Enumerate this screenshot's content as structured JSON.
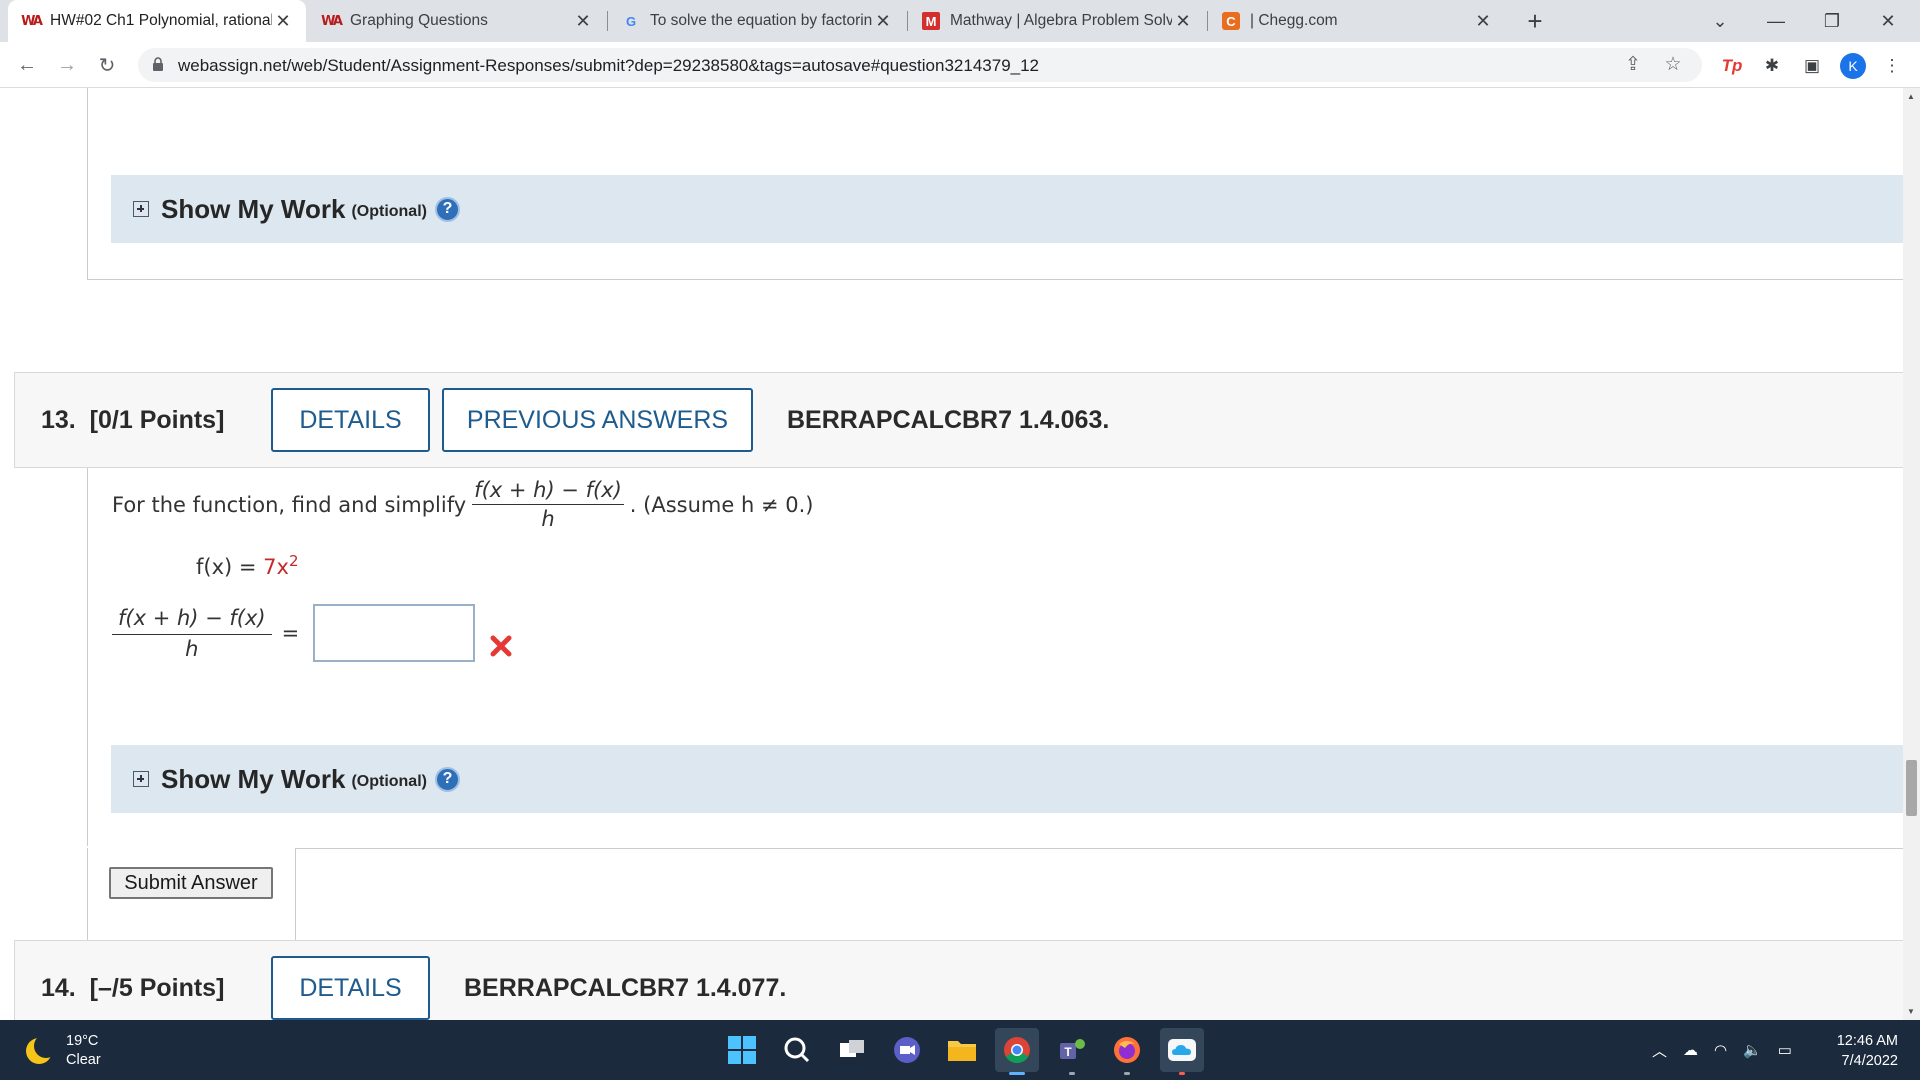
{
  "browser": {
    "tabs": [
      {
        "title": "HW#02 Ch1 Polynomial, rational",
        "favicon": "webassign-icon",
        "active": true
      },
      {
        "title": "Graphing Questions",
        "favicon": "webassign-icon",
        "active": false
      },
      {
        "title": "To solve the equation by factorin",
        "favicon": "google-icon",
        "active": false
      },
      {
        "title": "Mathway | Algebra Problem Solv",
        "favicon": "mathway-icon",
        "active": false
      },
      {
        "title": "| Chegg.com",
        "favicon": "chegg-icon",
        "active": false
      }
    ],
    "url": "webassign.net/web/Student/Assignment-Responses/submit?dep=29238580&tags=autosave#question3214379_12",
    "profile_initial": "K",
    "tp_label": "Tp"
  },
  "page": {
    "prev_question": {
      "show_work_title": "Show My Work",
      "show_work_optional": "(Optional)"
    },
    "q13": {
      "number": "13.",
      "points": "[0/1 Points]",
      "details_label": "DETAILS",
      "previous_answers_label": "PREVIOUS ANSWERS",
      "code": "BERRAPCALCBR7 1.4.063.",
      "prompt_before": "For the function, find and simplify",
      "frac_num": "f(x + h) − f(x)",
      "frac_den": "h",
      "prompt_after": ". (Assume h ≠ 0.)",
      "function_lhs": "f(x) = ",
      "function_rhs": "7x",
      "function_exp": "2",
      "answer_equals": "=",
      "answer_value": "",
      "answer_status": "incorrect",
      "show_work_title": "Show My Work",
      "show_work_optional": "(Optional)",
      "submit_label": "Submit Answer"
    },
    "q14": {
      "number": "14.",
      "points": "[–/5 Points]",
      "details_label": "DETAILS",
      "code": "BERRAPCALCBR7 1.4.077."
    }
  },
  "taskbar": {
    "temperature": "19°C",
    "condition": "Clear",
    "time": "12:46 AM",
    "date": "7/4/2022"
  },
  "colors": {
    "accent_blue": "#1e5b8e",
    "show_work_bg": "#dde7f0",
    "incorrect_red": "#e53935"
  }
}
